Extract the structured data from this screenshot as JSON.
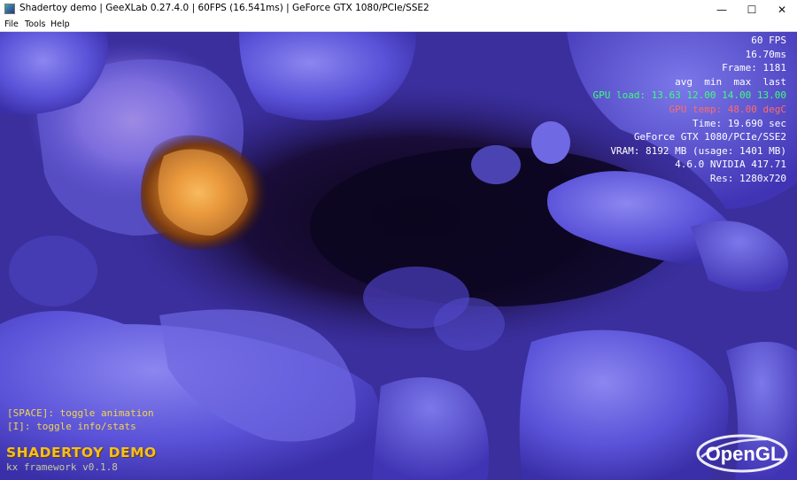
{
  "window": {
    "title": "Shadertoy demo | GeeXLab 0.27.4.0 | 60FPS (16.541ms) | GeForce GTX 1080/PCIe/SSE2",
    "app_icon": "geexlab-icon",
    "controls": {
      "minimize": "—",
      "maximize": "☐",
      "close": "✕"
    }
  },
  "menu": {
    "items": [
      {
        "label": "File"
      },
      {
        "label": "Tools"
      },
      {
        "label": "Help"
      }
    ]
  },
  "stats": {
    "fps": "60 FPS",
    "ms": "16.70ms",
    "frame": "Frame: 1181",
    "header": "avg  min  max  last",
    "gpu_load": "GPU load: 13.63 12.00 14.00 13.00",
    "gpu_temp": "GPU temp: 48.00 degC",
    "time": "Time: 19.690 sec",
    "gpu_name": "GeForce GTX 1080/PCIe/SSE2",
    "vram": "VRAM: 8192 MB (usage: 1401 MB)",
    "driver": "4.6.0 NVIDIA 417.71",
    "res": "Res: 1280x720"
  },
  "help": {
    "space": "[SPACE]: toggle animation",
    "info": "[I]: toggle info/stats"
  },
  "brand": {
    "title": "SHADERTOY DEMO",
    "subtitle": "kx framework v0.1.8"
  },
  "logo": {
    "text": "OpenGL",
    "icon": "opengl-logo"
  },
  "colors": {
    "stats_text": "#ffffff",
    "gpu_load": "#3dff7a",
    "gpu_temp": "#ff6a6a",
    "help_text": "#f2d64a",
    "brand": "#f3c020"
  }
}
